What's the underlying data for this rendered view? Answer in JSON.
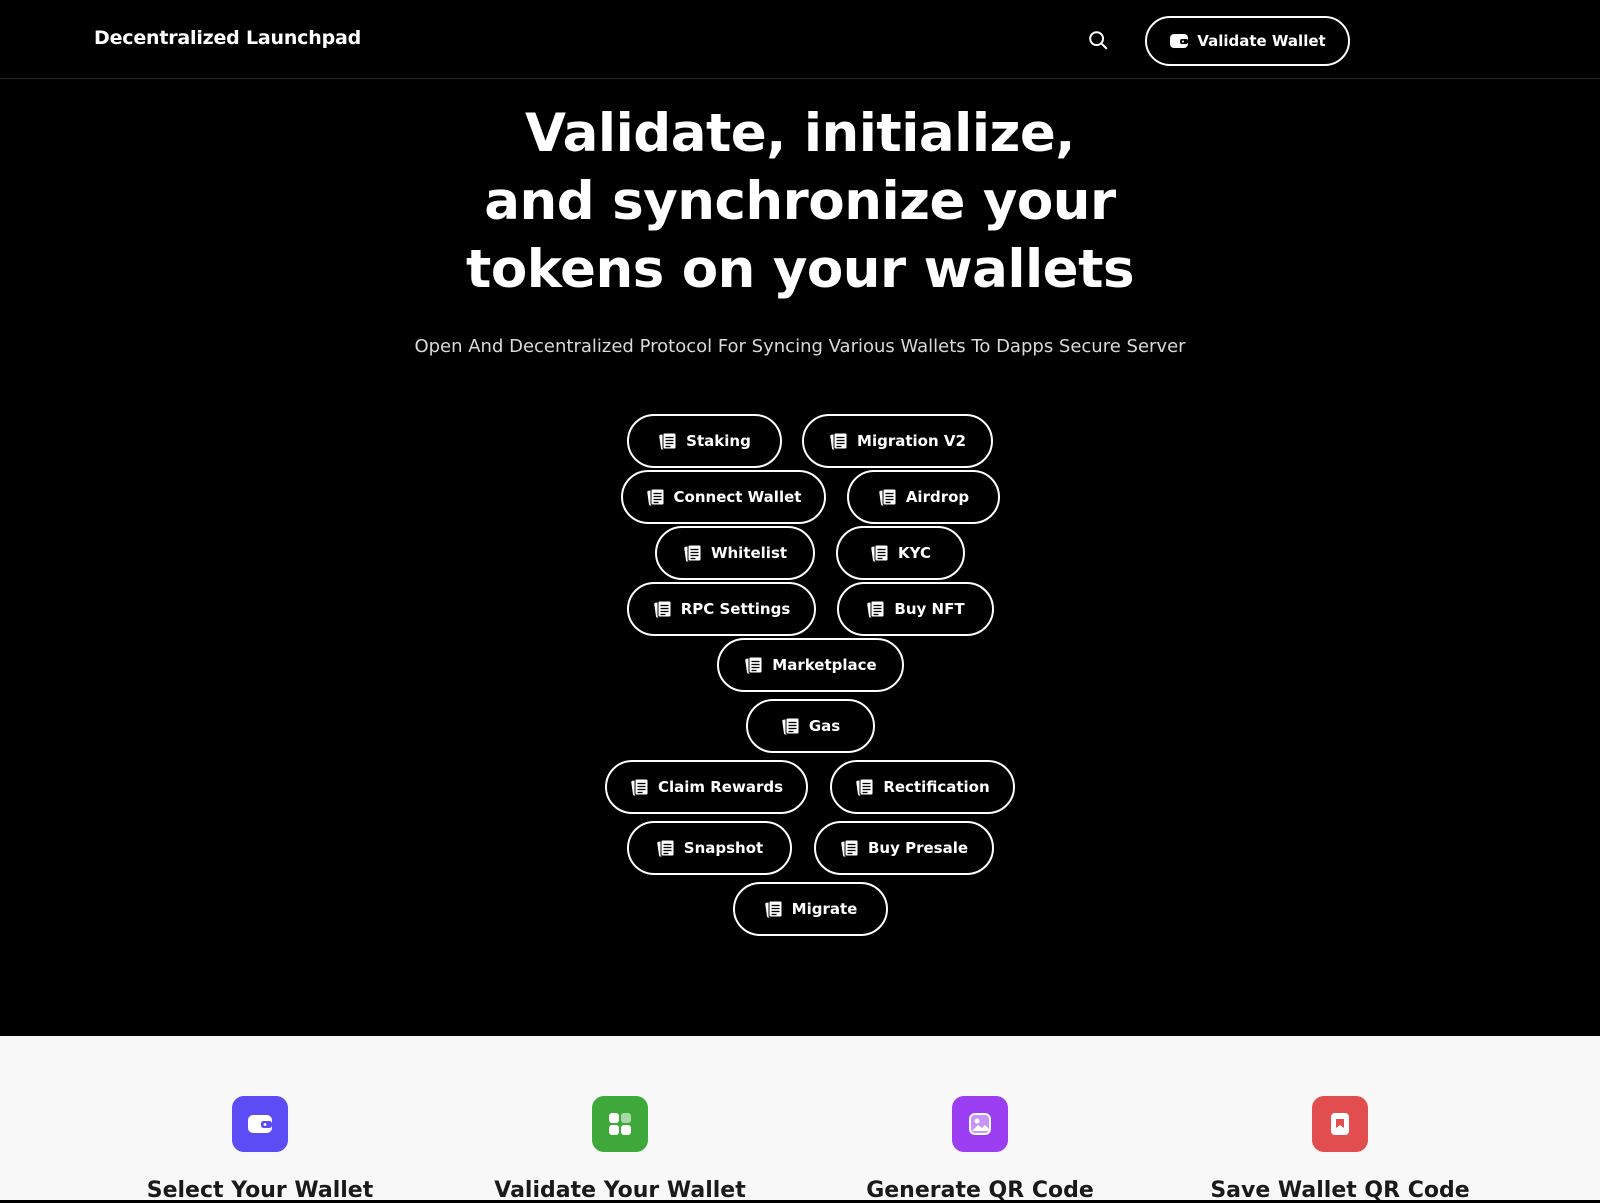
{
  "header": {
    "brand": "Decentralized Launchpad",
    "search_icon": "search-icon",
    "validate_button": "Validate Wallet",
    "validate_icon": "wallet-icon"
  },
  "hero": {
    "title_lines": [
      "Validate, initialize,",
      "and synchronize your",
      "tokens on your wallets"
    ],
    "subtitle": "Open And Decentralized Protocol For Syncing Various Wallets To Dapps Secure Server"
  },
  "pill_icon": "document-icon",
  "pills": [
    "Staking",
    "Migration V2",
    "Connect Wallet",
    "Airdrop",
    "Whitelist",
    "KYC",
    "RPC Settings",
    "Buy NFT",
    "Marketplace",
    "Gas",
    "Claim Rewards",
    "Rectification",
    "Snapshot",
    "Buy Presale",
    "Migrate"
  ],
  "features": [
    {
      "title": "Select Your Wallet",
      "icon": "wallet-icon",
      "color": "#5b4cf5"
    },
    {
      "title": "Validate Your Wallet",
      "icon": "grid-icon",
      "color": "#3ea83b"
    },
    {
      "title": "Generate QR Code",
      "icon": "image-icon",
      "color": "#9b3df0"
    },
    {
      "title": "Save Wallet QR Code",
      "icon": "bookmark-icon",
      "color": "#e24d4f"
    }
  ]
}
